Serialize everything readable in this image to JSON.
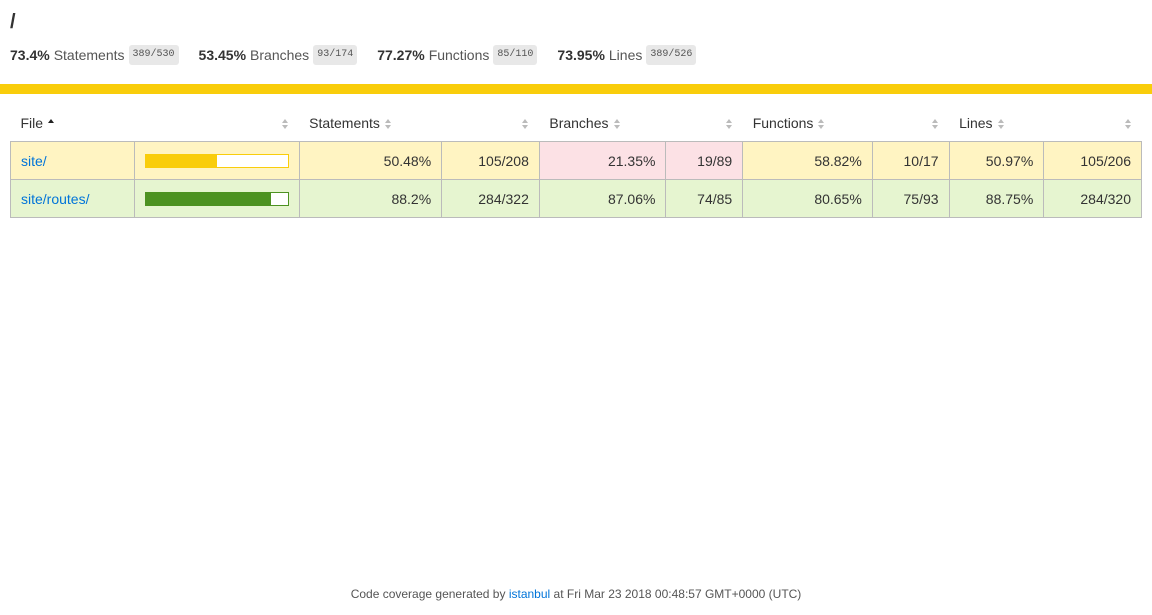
{
  "page": {
    "title": "/"
  },
  "summary": [
    {
      "pct": "73.4%",
      "label": "Statements",
      "fraction": "389/530"
    },
    {
      "pct": "53.45%",
      "label": "Branches",
      "fraction": "93/174"
    },
    {
      "pct": "77.27%",
      "label": "Functions",
      "fraction": "85/110"
    },
    {
      "pct": "73.95%",
      "label": "Lines",
      "fraction": "389/526"
    }
  ],
  "colors": {
    "medium": "#f9cd0b",
    "high": "#4d9221",
    "low_bg": "#fce1e5",
    "medium_bg": "#fff4c2",
    "high_bg": "#e6f5d0",
    "link": "#0074d9"
  },
  "table": {
    "headers": {
      "file": "File",
      "statements": "Statements",
      "branches": "Branches",
      "functions": "Functions",
      "lines": "Lines"
    },
    "rows": [
      {
        "file": "site/",
        "bar_fraction": 0.5048,
        "level": "medium",
        "statements_pct": "50.48%",
        "statements_frac": "105/208",
        "branches_pct": "21.35%",
        "branches_frac": "19/89",
        "functions_pct": "58.82%",
        "functions_frac": "10/17",
        "lines_pct": "50.97%",
        "lines_frac": "105/206"
      },
      {
        "file": "site/routes/",
        "bar_fraction": 0.882,
        "level": "high",
        "statements_pct": "88.2%",
        "statements_frac": "284/322",
        "branches_pct": "87.06%",
        "branches_frac": "74/85",
        "functions_pct": "80.65%",
        "functions_frac": "75/93",
        "lines_pct": "88.75%",
        "lines_frac": "284/320"
      }
    ]
  },
  "footer": {
    "prefix": "Code coverage generated by",
    "link": "istanbul",
    "suffix": "at Fri Mar 23 2018 00:48:57 GMT+0000 (UTC)"
  }
}
